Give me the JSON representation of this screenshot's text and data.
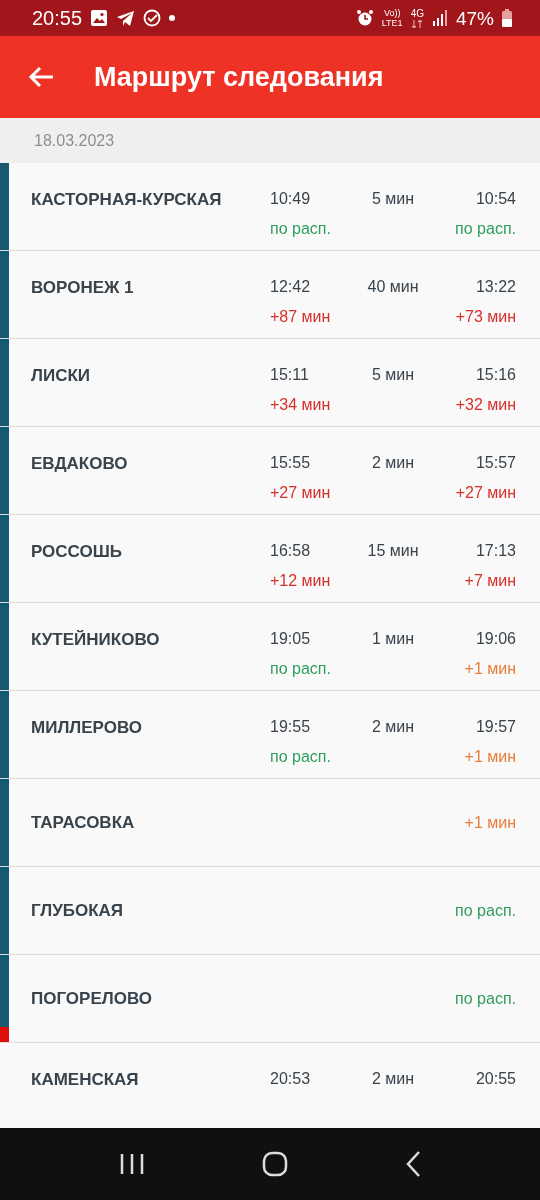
{
  "status_bar": {
    "time": "20:55",
    "volte": "Vo))",
    "lte": "LTE1",
    "network": "4G",
    "battery": "47%"
  },
  "header": {
    "title": "Маршрут следования"
  },
  "date": "18.03.2023",
  "stops": [
    {
      "name": "КАСТОРНАЯ-КУРСКАЯ",
      "arrival": "10:49",
      "stop": "5 мин",
      "departure": "10:54",
      "arrival_delay": {
        "text": "по расп.",
        "kind": "ontime"
      },
      "departure_delay": {
        "text": "по расп.",
        "kind": "ontime"
      },
      "passed": true,
      "current": false
    },
    {
      "name": "ВОРОНЕЖ 1",
      "arrival": "12:42",
      "stop": "40 мин",
      "departure": "13:22",
      "arrival_delay": {
        "text": "+87 мин",
        "kind": "late"
      },
      "departure_delay": {
        "text": "+73 мин",
        "kind": "late"
      },
      "passed": true,
      "current": false
    },
    {
      "name": "ЛИСКИ",
      "arrival": "15:11",
      "stop": "5 мин",
      "departure": "15:16",
      "arrival_delay": {
        "text": "+34 мин",
        "kind": "late"
      },
      "departure_delay": {
        "text": "+32 мин",
        "kind": "late"
      },
      "passed": true,
      "current": false
    },
    {
      "name": "ЕВДАКОВО",
      "arrival": "15:55",
      "stop": "2 мин",
      "departure": "15:57",
      "arrival_delay": {
        "text": "+27 мин",
        "kind": "late"
      },
      "departure_delay": {
        "text": "+27 мин",
        "kind": "late"
      },
      "passed": true,
      "current": false
    },
    {
      "name": "РОССОШЬ",
      "arrival": "16:58",
      "stop": "15 мин",
      "departure": "17:13",
      "arrival_delay": {
        "text": "+12 мин",
        "kind": "late"
      },
      "departure_delay": {
        "text": "+7 мин",
        "kind": "late"
      },
      "passed": true,
      "current": false
    },
    {
      "name": "КУТЕЙНИКОВО",
      "arrival": "19:05",
      "stop": "1 мин",
      "departure": "19:06",
      "arrival_delay": {
        "text": "по расп.",
        "kind": "ontime"
      },
      "departure_delay": {
        "text": "+1 мин",
        "kind": "minor"
      },
      "passed": true,
      "current": false
    },
    {
      "name": "МИЛЛЕРОВО",
      "arrival": "19:55",
      "stop": "2 мин",
      "departure": "19:57",
      "arrival_delay": {
        "text": "по расп.",
        "kind": "ontime"
      },
      "departure_delay": {
        "text": "+1 мин",
        "kind": "minor"
      },
      "passed": true,
      "current": false
    },
    {
      "name": "ТАРАСОВКА",
      "departure_delay": {
        "text": "+1 мин",
        "kind": "minor"
      },
      "passed": true,
      "current": false
    },
    {
      "name": "ГЛУБОКАЯ",
      "departure_delay": {
        "text": "по расп.",
        "kind": "ontime"
      },
      "passed": true,
      "current": false
    },
    {
      "name": "ПОГОРЕЛОВО",
      "departure_delay": {
        "text": "по расп.",
        "kind": "ontime"
      },
      "passed": true,
      "current": true
    },
    {
      "name": "КАМЕНСКАЯ",
      "arrival": "20:53",
      "stop": "2 мин",
      "departure": "20:55",
      "passed": false,
      "current": false
    }
  ]
}
